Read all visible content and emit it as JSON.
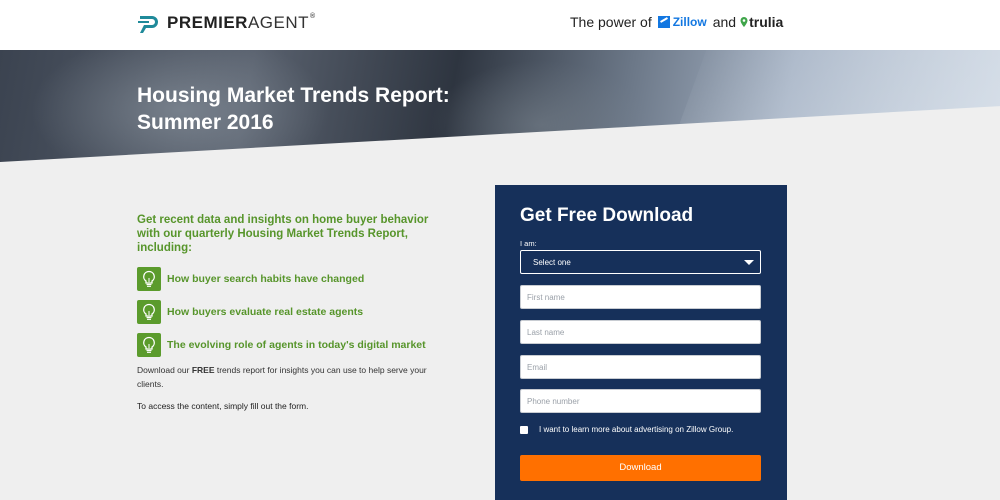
{
  "header": {
    "logo": {
      "bold": "PREMIER",
      "light": "AGENT",
      "tm": "®",
      "icon": "premier-agent-logo-icon"
    },
    "power_text": "The power of",
    "zillow": "Zillow",
    "and": "and",
    "trulia": "trulia",
    "zillow_color": "#1277e1"
  },
  "hero": {
    "title": "Housing Market Trends Report: Summer 2016"
  },
  "content": {
    "intro": "Get recent data and insights on home buyer behavior with our quarterly Housing Market Trends Report, including:",
    "bullets": [
      {
        "label": "How buyer search habits have changed",
        "icon": "lightbulb-icon"
      },
      {
        "label": "How buyers evaluate real estate agents",
        "icon": "lightbulb-icon"
      },
      {
        "label": "The evolving role of agents in today's digital market",
        "icon": "lightbulb-icon"
      }
    ],
    "body_pre": "Download our ",
    "body_bold": "FREE",
    "body_post": " trends report for insights you can use to help serve your clients.",
    "body2": "To access the content, simply fill out the form.",
    "accent_color": "#57952b"
  },
  "form": {
    "title": "Get Free Download",
    "iam_label": "I am:",
    "select_value": "Select one",
    "first_name_placeholder": "First name",
    "last_name_placeholder": "Last name",
    "email_placeholder": "Email",
    "phone_placeholder": "Phone number",
    "checkbox_label": "I want to learn more about advertising on Zillow Group.",
    "button_label": "Download",
    "panel_color": "#16305a",
    "button_color": "#ff7000"
  }
}
